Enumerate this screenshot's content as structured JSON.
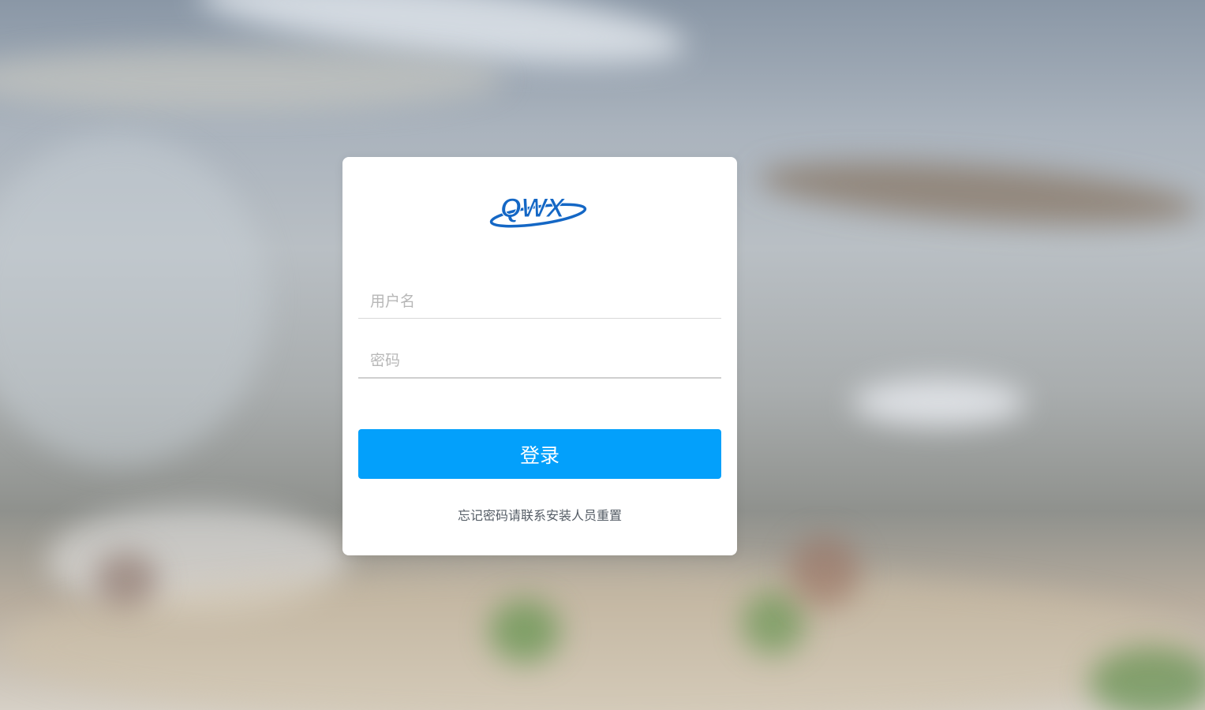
{
  "login": {
    "logo_text": "QWX",
    "username_placeholder": "用户名",
    "password_placeholder": "密码",
    "submit_label": "登录",
    "forgot_hint": "忘记密码请联系安装人员重置"
  },
  "colors": {
    "primary": "#03a0fb",
    "logo_blue": "#1467c5",
    "card_bg": "#ffffff"
  }
}
